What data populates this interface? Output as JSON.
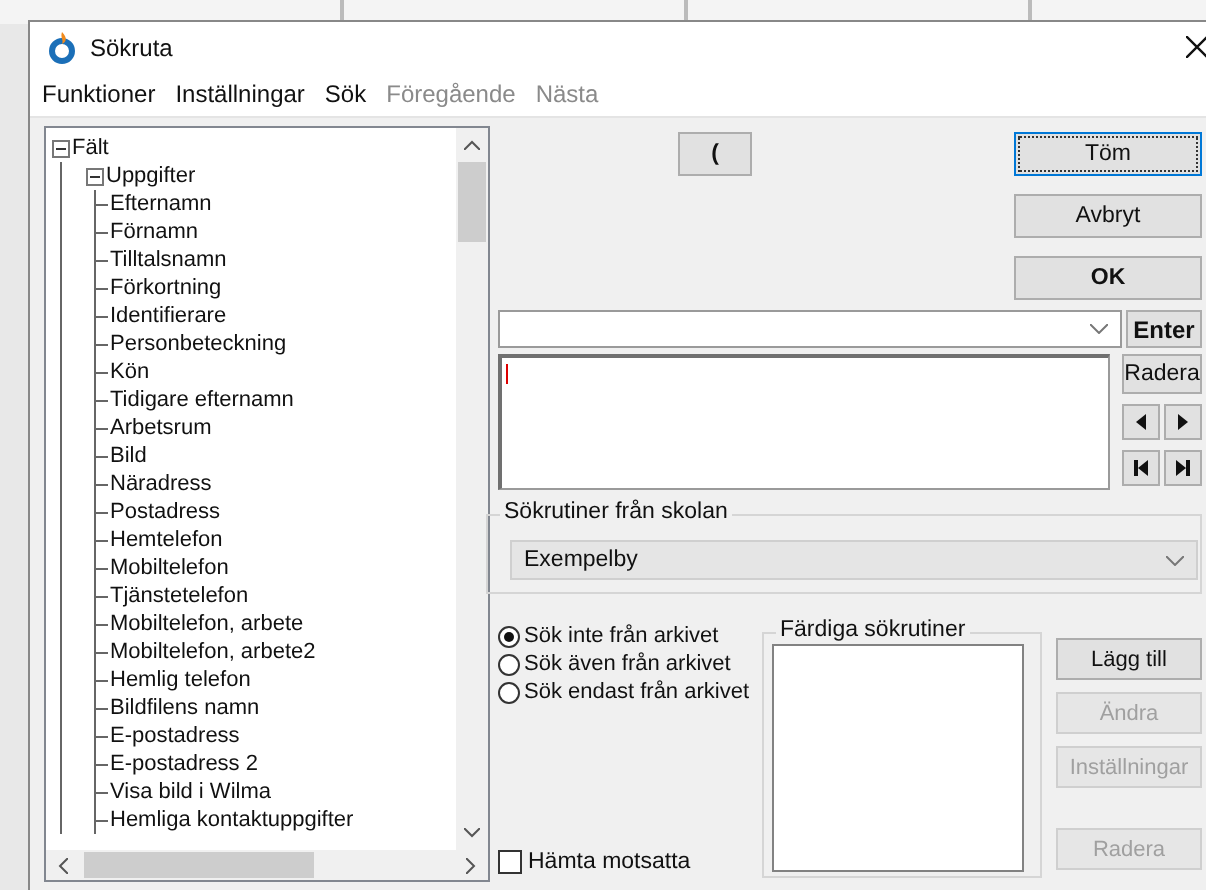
{
  "window": {
    "title": "Sökruta"
  },
  "menu": [
    {
      "label": "Funktioner",
      "disabled": false
    },
    {
      "label": "Inställningar",
      "disabled": false
    },
    {
      "label": "Sök",
      "disabled": false
    },
    {
      "label": "Föregående",
      "disabled": true
    },
    {
      "label": "Nästa",
      "disabled": true
    }
  ],
  "tree": [
    {
      "label": "Fält",
      "expanded": true,
      "children": [
        {
          "label": "Uppgifter",
          "expanded": true,
          "children": [
            {
              "label": "Efternamn"
            },
            {
              "label": "Förnamn"
            },
            {
              "label": "Tilltalsnamn"
            },
            {
              "label": "Förkortning"
            },
            {
              "label": "Identifierare"
            },
            {
              "label": "Personbeteckning"
            },
            {
              "label": "Kön"
            },
            {
              "label": "Tidigare efternamn"
            },
            {
              "label": "Arbetsrum"
            },
            {
              "label": "Bild"
            },
            {
              "label": "Näradress"
            },
            {
              "label": "Postadress"
            },
            {
              "label": "Hemtelefon"
            },
            {
              "label": "Mobiltelefon"
            },
            {
              "label": "Tjänstetelefon"
            },
            {
              "label": "Mobiltelefon, arbete"
            },
            {
              "label": "Mobiltelefon, arbete2"
            },
            {
              "label": "Hemlig telefon"
            },
            {
              "label": "Bildfilens namn"
            },
            {
              "label": "E-postadress"
            },
            {
              "label": "E-postadress 2"
            },
            {
              "label": "Visa bild i Wilma"
            },
            {
              "label": "Hemliga kontaktuppgifter"
            }
          ]
        }
      ]
    }
  ],
  "paren_button": {
    "label": "("
  },
  "action_buttons": [
    {
      "label": "Töm",
      "focused": true,
      "bold": false
    },
    {
      "label": "Avbryt",
      "focused": false,
      "bold": false
    },
    {
      "label": "OK",
      "focused": false,
      "bold": true
    }
  ],
  "enter_button": {
    "label": "Enter"
  },
  "delete_button": {
    "label": "Radera"
  },
  "school_routines": {
    "label": "Sökrutiner från skolan",
    "value": "Exempelby"
  },
  "archive_options": [
    {
      "label": "Sök inte från arkivet",
      "selected": true
    },
    {
      "label": "Sök även från arkivet",
      "selected": false
    },
    {
      "label": "Sök endast från arkivet",
      "selected": false
    }
  ],
  "ready_routines": {
    "label": "Färdiga sökrutiner",
    "buttons": [
      {
        "label": "Lägg till",
        "disabled": false
      },
      {
        "label": "Ändra",
        "disabled": true
      },
      {
        "label": "Inställningar",
        "disabled": true
      },
      {
        "label": "Radera",
        "disabled": true
      }
    ]
  },
  "fetch_opposite": {
    "label": "Hämta motsatta",
    "checked": false
  }
}
